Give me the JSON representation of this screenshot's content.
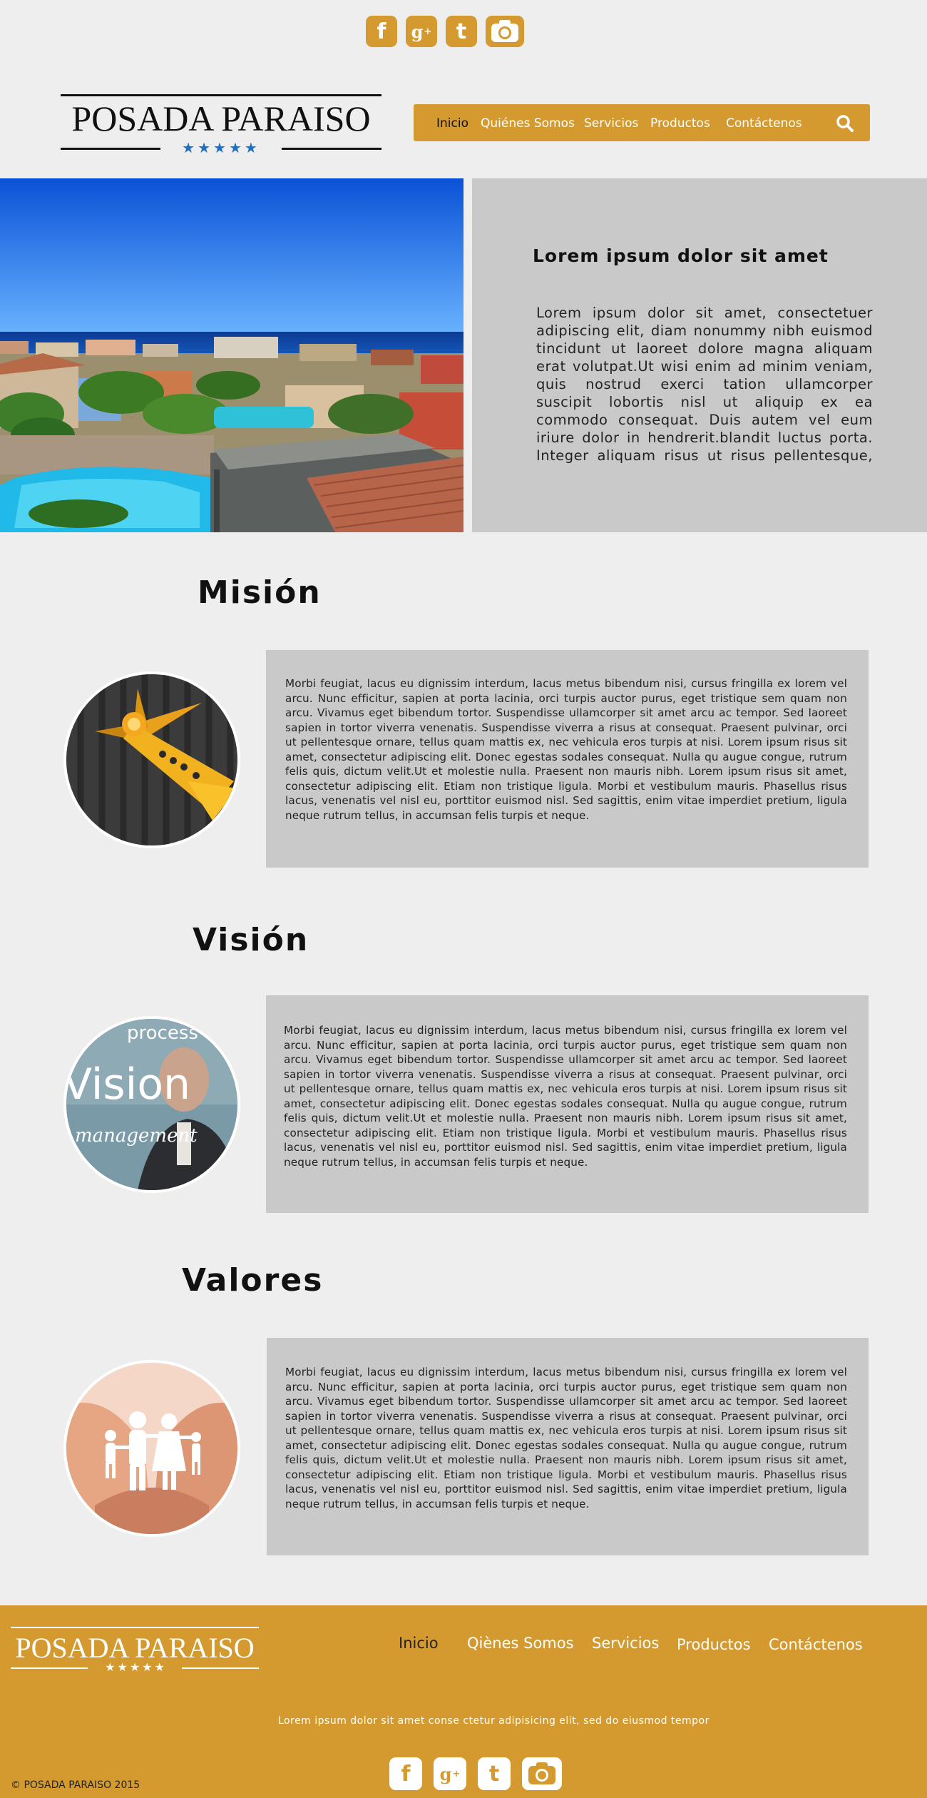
{
  "header": {
    "social": [
      {
        "icon": "facebook-icon",
        "glyph": "f"
      },
      {
        "icon": "google-plus-icon",
        "glyph": "g"
      },
      {
        "icon": "tumblr-icon",
        "glyph": "t"
      },
      {
        "icon": "camera-icon",
        "glyph": ""
      }
    ],
    "logo": {
      "title": "POSADA PARAISO",
      "stars": "★★★★★"
    },
    "nav": [
      "Inicio",
      "Quiénes Somos",
      "Servicios",
      "Productos",
      "Contáctenos"
    ],
    "search_icon": "search-icon"
  },
  "hero": {
    "title": "Lorem ipsum dolor sit amet",
    "text": "Lorem ipsum dolor sit amet, consectetuer adipiscing elit, diam nonummy nibh euismod tincidunt ut laoreet dolore magna aliquam erat volutpat.Ut wisi enim ad minim veniam, quis nostrud exerci tation ullamcorper suscipit lobortis nisl ut aliquip ex ea commodo consequat. Duis autem vel eum iriure dolor in hendrerit.blandit luctus porta. Integer aliquam risus ut risus pellentesque,"
  },
  "sections": {
    "mision": {
      "title": "Misión",
      "text": "Morbi feugiat, lacus eu dignissim interdum, lacus metus bibendum nisi, cursus fringilla ex lorem vel arcu. Nunc efficitur, sapien at porta lacinia, orci turpis auctor purus, eget tristique sem quam non arcu. Vivamus eget bibendum tortor. Suspendisse ullamcorper sit amet arcu ac tempor. Sed laoreet sapien in tortor viverra venenatis. Suspendisse viverra a risus at consequat. Praesent pulvinar, orci ut pellentesque ornare, tellus quam mattis ex, nec vehicula eros turpis at nisi. Lorem ipsum risus sit amet, consectetur adipiscing elit. Donec egestas sodales consequat. Nulla qu augue congue, rutrum felis quis, dictum velit.Ut et molestie nulla. Praesent non mauris nibh. Lorem ipsum risus sit amet, consectetur adipiscing elit. Etiam non tristique ligula. Morbi et vestibulum mauris. Phasellus risus lacus, venenatis vel nisl eu, porttitor euismod nisl. Sed sagittis, enim vitae imperdiet pretium, ligula neque rutrum tellus, in accumsan felis turpis et neque."
    },
    "vision": {
      "title": "Visión",
      "image_text": {
        "process": "process",
        "vision": "Vision",
        "management": "management"
      },
      "text": "Morbi feugiat, lacus eu dignissim interdum, lacus metus bibendum nisi, cursus fringilla ex lorem vel arcu. Nunc efficitur, sapien at porta lacinia, orci turpis auctor purus, eget tristique sem quam non arcu. Vivamus eget bibendum tortor. Suspendisse ullamcorper sit amet arcu ac tempor. Sed laoreet sapien in tortor viverra venenatis. Suspendisse viverra a risus at consequat. Praesent pulvinar, orci ut pellentesque ornare, tellus quam mattis ex, nec vehicula eros turpis at nisi. Lorem ipsum risus sit amet, consectetur adipiscing elit. Donec egestas sodales consequat. Nulla qu augue congue, rutrum felis quis, dictum velit.Ut et molestie nulla. Praesent non mauris nibh. Lorem ipsum risus sit amet, consectetur adipiscing elit. Etiam non tristique ligula. Morbi et vestibulum mauris. Phasellus risus lacus, venenatis vel nisl eu, porttitor euismod nisl. Sed sagittis, enim vitae imperdiet pretium, ligula neque rutrum tellus, in accumsan felis turpis et neque."
    },
    "valores": {
      "title": "Valores",
      "text": "Morbi feugiat, lacus eu dignissim interdum, lacus metus bibendum nisi, cursus fringilla ex lorem vel arcu. Nunc efficitur, sapien at porta lacinia, orci turpis auctor purus, eget tristique sem quam non arcu. Vivamus eget bibendum tortor. Suspendisse ullamcorper sit amet arcu ac tempor. Sed laoreet sapien in tortor viverra venenatis. Suspendisse viverra a risus at consequat. Praesent pulvinar, orci ut pellentesque ornare, tellus quam mattis ex, nec vehicula eros turpis at nisi. Lorem ipsum risus sit amet, consectetur adipiscing elit. Donec egestas sodales consequat. Nulla qu augue congue, rutrum felis quis, dictum velit.Ut et molestie nulla. Praesent non mauris nibh. Lorem ipsum risus sit amet, consectetur adipiscing elit. Etiam non tristique ligula. Morbi et vestibulum mauris. Phasellus risus lacus, venenatis vel nisl eu, porttitor euismod nisl. Sed sagittis, enim vitae imperdiet pretium, ligula neque rutrum tellus, in accumsan felis turpis et neque."
    }
  },
  "footer": {
    "logo": {
      "title": "POSADA PARAISO",
      "stars": "★★★★★"
    },
    "nav": [
      "Inicio",
      "Qiènes Somos",
      "Servicios",
      "Productos",
      "Contáctenos"
    ],
    "tagline": "Lorem ipsum dolor sit amet conse ctetur adipisicing elit, sed do eiusmod tempor",
    "copyright": "© POSADA PARAISO 2015"
  },
  "colors": {
    "accent": "#d49a2f",
    "panel": "#c9c9c9",
    "background": "#eeeeee",
    "star_blue": "#1f6fc4"
  }
}
